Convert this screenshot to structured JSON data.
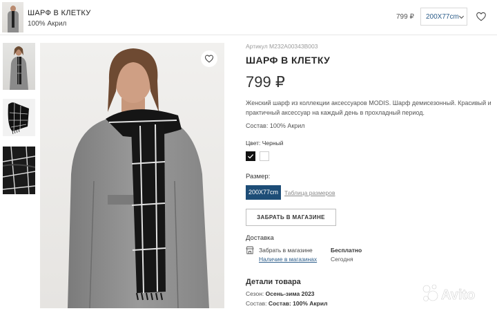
{
  "header": {
    "title": "ШАРФ В КЛЕТКУ",
    "subtitle": "100% Акрил",
    "price": "799 ₽",
    "selected_size": "200X77cm",
    "icons": [
      "chevron-down-icon",
      "heart-icon"
    ]
  },
  "product": {
    "sku": "Артикул M232A00343B003",
    "title": "ШАРФ В КЛЕТКУ",
    "price": "799 ₽",
    "description": "Женский шарф из коллекции аксессуаров MODIS. Шарф демисезонный. Красивый и практичный аксессуар на каждый день в прохладный период.",
    "composition": "Состав: 100% Акрил",
    "color_label": "Цвет: Черный",
    "colors": [
      {
        "name": "Черный",
        "hex": "#111111",
        "selected": true
      },
      {
        "name": "Белый",
        "hex": "#ffffff",
        "selected": false
      }
    ],
    "size_label": "Размер:",
    "sizes": [
      "200X77cm"
    ],
    "size_table_link": "Таблица размеров",
    "pickup_button": "ЗАБРАТЬ В МАГАЗИНЕ"
  },
  "delivery": {
    "heading": "Доставка",
    "method": "Забрать в магазине",
    "availability_link": "Наличие в магазинах",
    "cost": "Бесплатно",
    "when": "Сегодня"
  },
  "details": {
    "heading": "Детали товара",
    "season_label": "Сезон:",
    "season_value": "Осень-зима 2023",
    "composition_label": "Состав:",
    "composition_value": "Состав: 100% Акрил"
  },
  "gallery": {
    "thumbnails": [
      "model-photo",
      "folded-scarf-photo",
      "fabric-closeup-photo"
    ],
    "icons": [
      "heart-icon"
    ]
  },
  "watermark": "Avito",
  "colors": {
    "accent": "#1d4d77",
    "link": "#2c5d8a",
    "text": "#222222",
    "muted": "#9a9a9a"
  }
}
